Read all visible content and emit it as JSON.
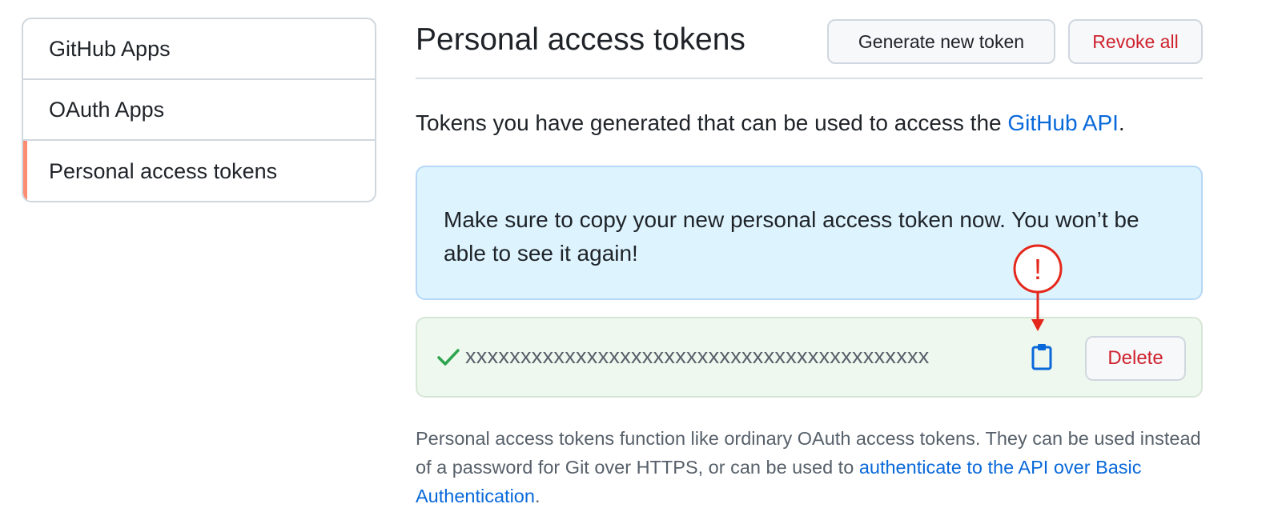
{
  "sidebar": {
    "items": [
      {
        "label": "GitHub Apps"
      },
      {
        "label": "OAuth Apps"
      },
      {
        "label": "Personal access tokens",
        "selected": true
      }
    ]
  },
  "header": {
    "title": "Personal access tokens",
    "generate_label": "Generate new token",
    "revoke_label": "Revoke all"
  },
  "intro": {
    "text": "Tokens you have generated that can be used to access the ",
    "link": "GitHub API",
    "suffix": "."
  },
  "flash": {
    "message": "Make sure to copy your new personal access token now. You won’t be able to see it again!"
  },
  "token": {
    "value": "xxxxxxxxxxxxxxxxxxxxxxxxxxxxxxxxxxxxxxxxxx",
    "delete_label": "Delete",
    "check_icon": "check-icon",
    "copy_icon": "clipboard-icon"
  },
  "annotation": {
    "symbol": "!"
  },
  "description": {
    "text": "Personal access tokens function like ordinary OAuth access tokens. They can be used instead of a password for Git over HTTPS, or can be used to ",
    "link": "authenticate to the API over Basic Authentication",
    "suffix": "."
  },
  "colors": {
    "link": "#0969da",
    "danger": "#cf222e",
    "success": "#2da44e",
    "flash_bg": "#ddf4ff",
    "token_bg": "#eef8ee",
    "selected_marker": "#fd8c73",
    "annotation": "#e5271b"
  }
}
